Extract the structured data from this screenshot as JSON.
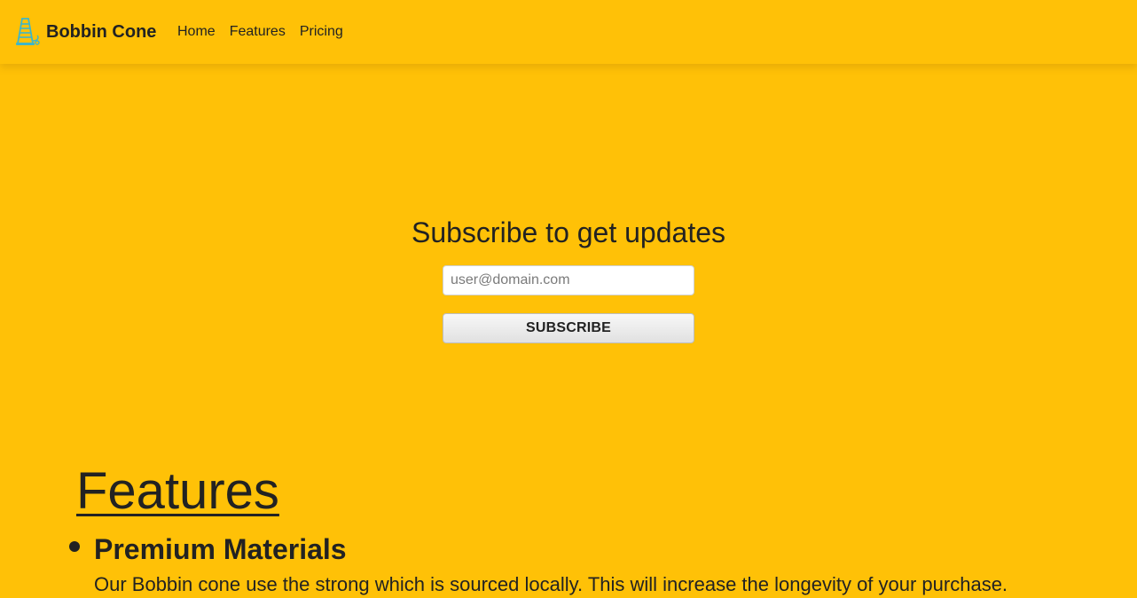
{
  "navbar": {
    "brand": {
      "icon": "thread-cone-icon",
      "name": "Bobbin Cone"
    },
    "links": [
      {
        "label": "Home"
      },
      {
        "label": "Features"
      },
      {
        "label": "Pricing"
      }
    ]
  },
  "hero": {
    "title": "Subscribe to get updates",
    "email_input": {
      "value": "",
      "placeholder": "user@domain.com"
    },
    "subscribe_label": "SUBSCRIBE"
  },
  "features": {
    "title": "Features",
    "items": [
      {
        "heading": "Premium Materials",
        "description": "Our Bobbin cone use the strong which is sourced locally. This will increase the longevity of your purchase."
      }
    ]
  },
  "colors": {
    "background": "#FFC107",
    "text": "#222222",
    "logo_thread": "#3EB6C8"
  }
}
